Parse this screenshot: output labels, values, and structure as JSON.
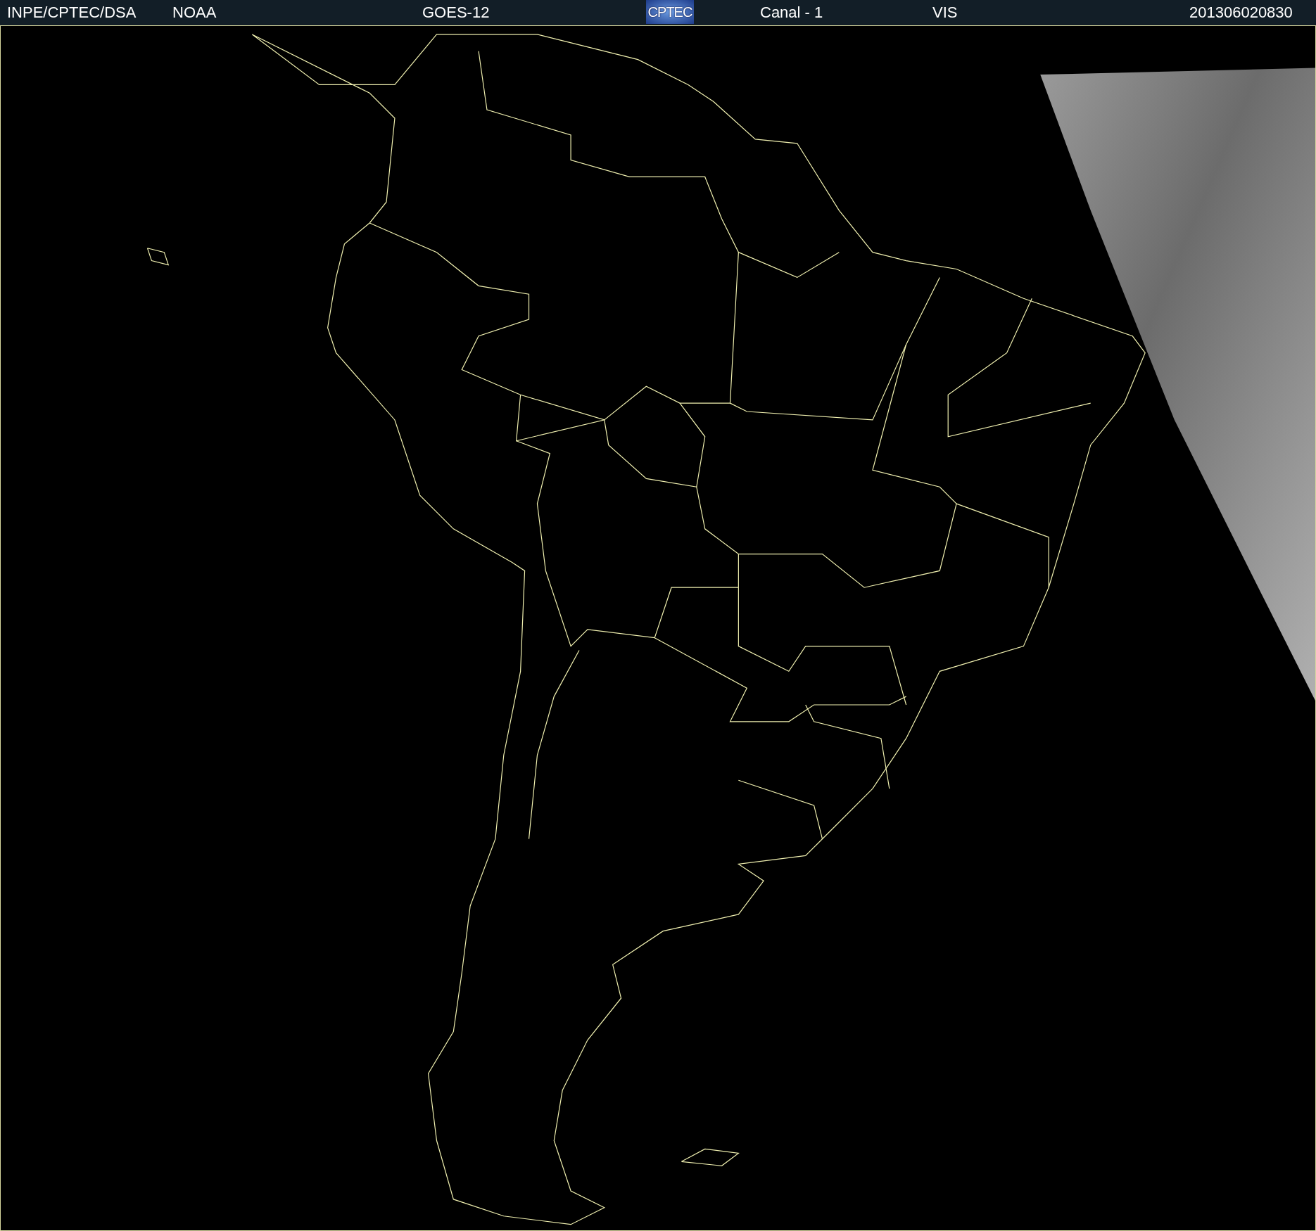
{
  "header": {
    "items": [
      {
        "kind": "text",
        "text": "INPE/CPTEC/DSA"
      },
      {
        "kind": "text",
        "text": "NOAA"
      },
      {
        "kind": "text",
        "text": "GOES-12"
      },
      {
        "kind": "logo",
        "text": "CPTEC"
      },
      {
        "kind": "text",
        "text": "Canal - 1"
      },
      {
        "kind": "text",
        "text": "VIS"
      },
      {
        "kind": "text",
        "text": "201306020830"
      }
    ]
  }
}
